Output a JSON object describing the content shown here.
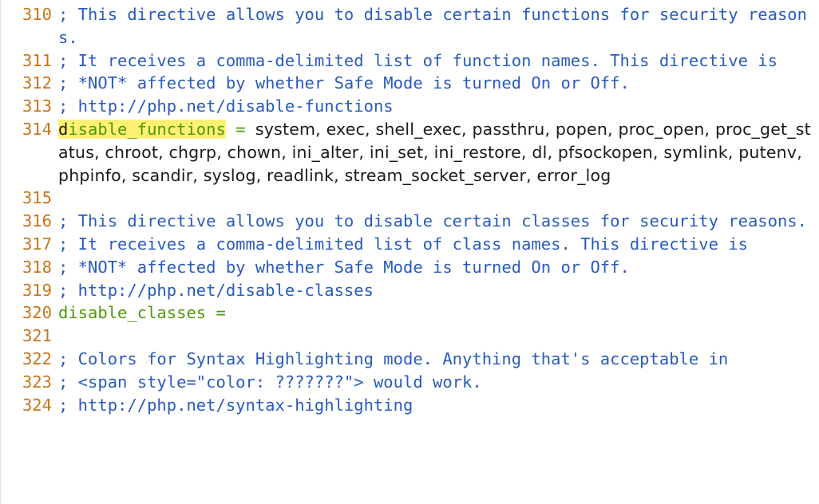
{
  "lines": [
    {
      "num": "310",
      "type": "comment",
      "text": "; This directive allows you to disable certain functions for security reasons."
    },
    {
      "num": "311",
      "type": "comment",
      "text": "; It receives a comma-delimited list of function names. This directive is"
    },
    {
      "num": "312",
      "type": "comment",
      "text": "; *NOT* affected by whether Safe Mode is turned On or Off."
    },
    {
      "num": "313",
      "type": "comment",
      "text": "; http://php.net/disable-functions"
    },
    {
      "num": "314",
      "type": "directive",
      "cursor_char": "d",
      "match_rest": "isable_functions",
      "eq": " = ",
      "value": "system, exec, shell_exec, passthru, popen, proc_open, proc_get_status, chroot, chgrp, chown, ini_alter, ini_set, ini_restore, dl, pfsockopen, symlink, putenv, phpinfo, scandir, syslog, readlink, stream_socket_server, error_log"
    },
    {
      "num": "315",
      "type": "blank",
      "text": ""
    },
    {
      "num": "316",
      "type": "comment",
      "text": "; This directive allows you to disable certain classes for security reasons."
    },
    {
      "num": "317",
      "type": "comment",
      "text": "; It receives a comma-delimited list of class names. This directive is"
    },
    {
      "num": "318",
      "type": "comment",
      "text": "; *NOT* affected by whether Safe Mode is turned On or Off."
    },
    {
      "num": "319",
      "type": "comment",
      "text": "; http://php.net/disable-classes"
    },
    {
      "num": "320",
      "type": "directive2",
      "key": "disable_classes",
      "eq": " ="
    },
    {
      "num": "321",
      "type": "blank",
      "text": ""
    },
    {
      "num": "322",
      "type": "comment",
      "text": "; Colors for Syntax Highlighting mode.  Anything that's acceptable in"
    },
    {
      "num": "323",
      "type": "comment",
      "text": "; <span style=\"color: ???????\"> would work."
    },
    {
      "num": "324",
      "type": "comment",
      "text": "; http://php.net/syntax-highlighting"
    }
  ]
}
